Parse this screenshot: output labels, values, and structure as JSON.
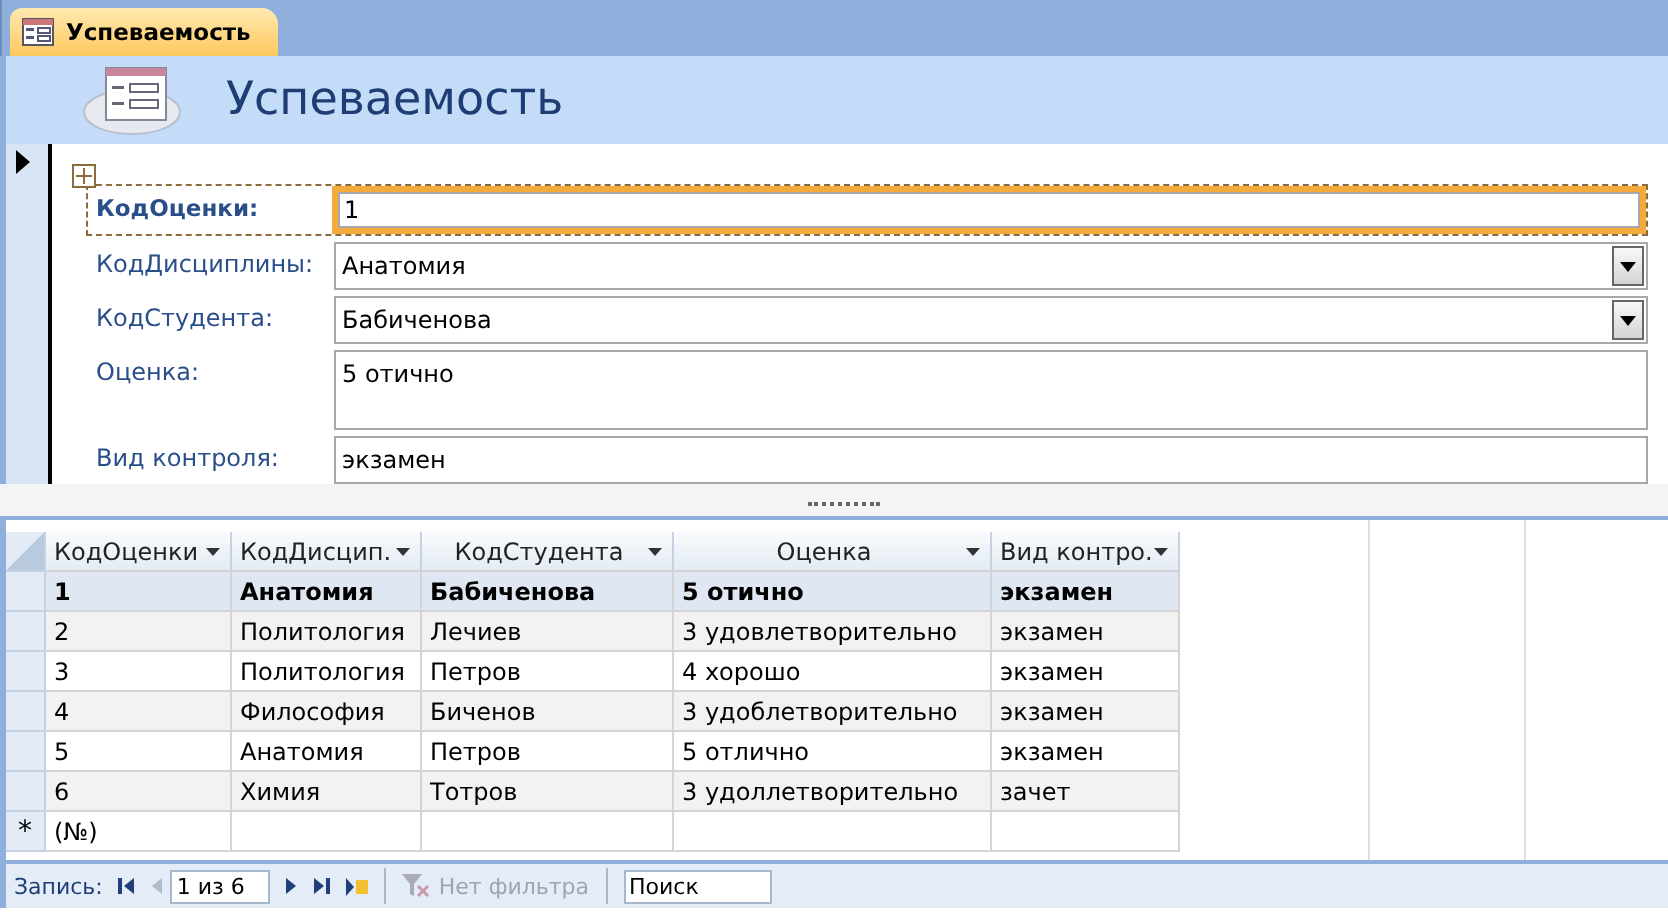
{
  "tab": {
    "label": "Успеваемость",
    "selected": true
  },
  "form": {
    "title": "Успеваемость",
    "fields": [
      {
        "label": "КодОценки:",
        "value": "1",
        "kind": "text",
        "focused": true
      },
      {
        "label": "КодДисциплины:",
        "value": "Анатомия",
        "kind": "combo",
        "focused": false
      },
      {
        "label": "КодСтудента:",
        "value": "Бабиченова",
        "kind": "combo",
        "focused": false
      },
      {
        "label": "Оценка:",
        "value": "5 отично",
        "kind": "memo",
        "focused": false
      },
      {
        "label": "Вид контроля:",
        "value": "экзамен",
        "kind": "text",
        "focused": false
      }
    ]
  },
  "table": {
    "columns": [
      "КодОценки",
      "КодДисцип.",
      "КодСтудента",
      "Оценка",
      "Вид контро."
    ],
    "rows": [
      {
        "cells": [
          "1",
          "Анатомия",
          "Бабиченова",
          "5 отично",
          "экзамен"
        ],
        "selected": true
      },
      {
        "cells": [
          "2",
          "Политология",
          "Лечиев",
          "3 удовлетворительно",
          "экзамен"
        ],
        "selected": false
      },
      {
        "cells": [
          "3",
          "Политология",
          "Петров",
          "4 хорошо",
          "экзамен"
        ],
        "selected": false
      },
      {
        "cells": [
          "4",
          "Философия",
          "Биченов",
          "3 удоблетворительно",
          "экзамен"
        ],
        "selected": false
      },
      {
        "cells": [
          "5",
          "Анатомия",
          "Петров",
          "5 отлично",
          "экзамен"
        ],
        "selected": false
      },
      {
        "cells": [
          "6",
          "Химия",
          "Тотров",
          "3 удоллетворительно",
          "зачет"
        ],
        "selected": false
      }
    ],
    "new_row": {
      "marker": "*",
      "value": "(№)"
    }
  },
  "navigator": {
    "label": "Запись:",
    "position": "1 из 6",
    "filter": {
      "label": "Нет фильтра",
      "disabled": true
    },
    "search": {
      "placeholder": "Поиск"
    }
  }
}
